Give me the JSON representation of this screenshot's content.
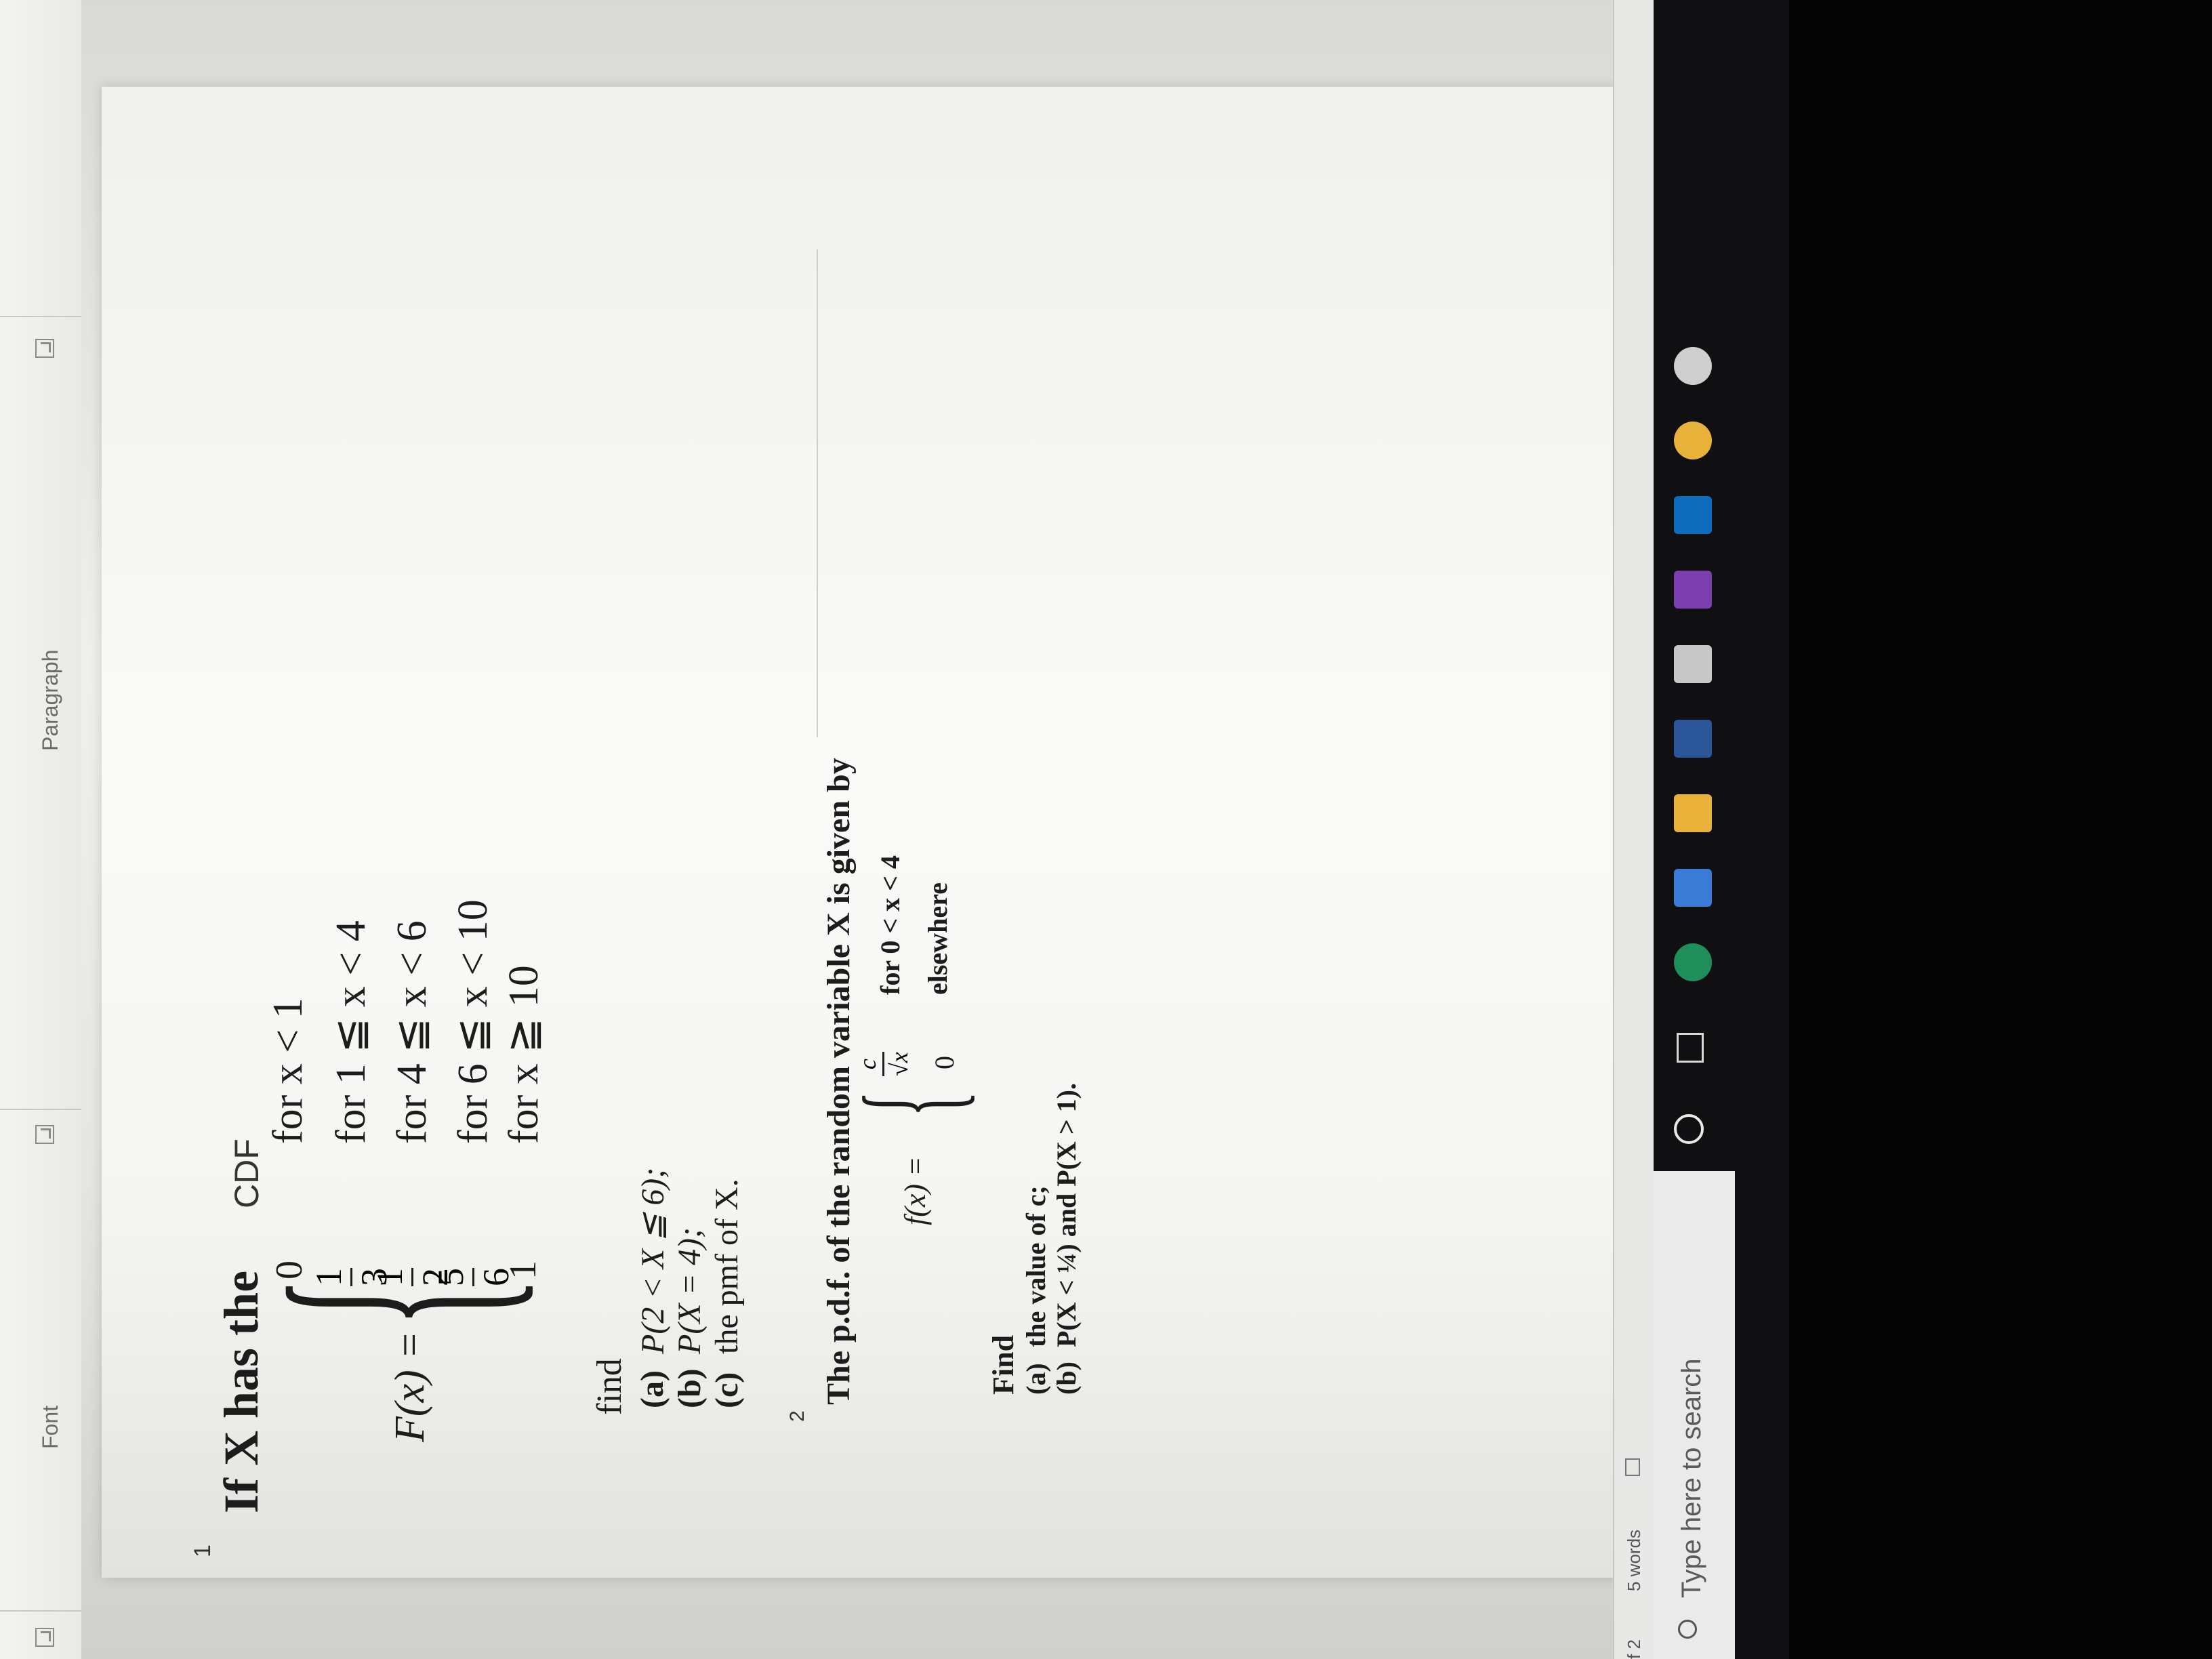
{
  "ribbon": {
    "font_label": "Font",
    "paragraph_label": "Paragraph"
  },
  "question1": {
    "number": "1",
    "intro": "If X has the",
    "intro_cdf": "CDF",
    "lhs": "F(x) =",
    "cases": [
      {
        "value": "0",
        "condition": "for x < 1"
      },
      {
        "value_num": "1",
        "value_den": "3",
        "condition": "for 1 ≦ x < 4"
      },
      {
        "value_num": "1",
        "value_den": "2",
        "condition": "for 4 ≦ x < 6"
      },
      {
        "value_num": "5",
        "value_den": "6",
        "condition": "for 6 ≦ x < 10"
      },
      {
        "value": "1",
        "condition": "for x ≧ 10"
      }
    ],
    "find_label": "find",
    "items": [
      {
        "tag": "(a)",
        "text": "P(2 < X ≦ 6);"
      },
      {
        "tag": "(b)",
        "text": "P(X = 4);"
      },
      {
        "tag": "(c)",
        "text": "the pmf  of X."
      }
    ]
  },
  "question2": {
    "number": "2",
    "intro": "The p.d.f. of the random variable X is given by",
    "lhs": "f(x) =",
    "case1_num": "c",
    "case1_den": "√x",
    "case1_condition": "for 0 < x < 4",
    "case2_value": "0",
    "case2_condition": "elsewhere",
    "find_label": "Find",
    "items": [
      {
        "tag": "(a)",
        "text": "the value of c;"
      },
      {
        "tag": "(b)",
        "text": "P(X < ¼) and P(X > 1)."
      }
    ]
  },
  "statusbar": {
    "page": "f 2",
    "words": "5 words"
  },
  "taskbar": {
    "search_placeholder": "Type here to search"
  },
  "colors": {
    "ribbon_bg": "#f0f0ee",
    "page_bg": "#fafaf8",
    "taskbar_bg": "#101013",
    "search_bg": "#eaeaea",
    "accent_word": "#2b579a",
    "accent_chrome": "#e8b23a",
    "accent_edge": "#1e8e5a",
    "accent_outlook": "#0f6cbd",
    "accent_onenote": "#7b3fb0"
  }
}
